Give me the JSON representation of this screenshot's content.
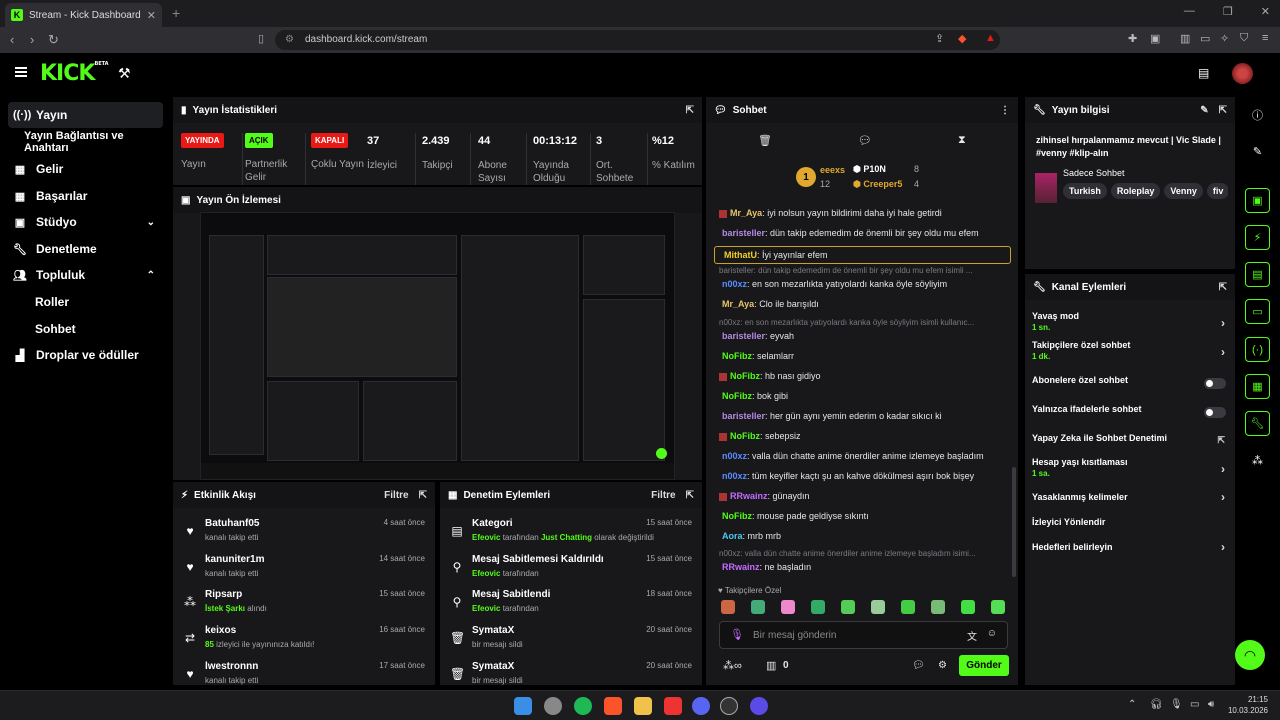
{
  "browser": {
    "tab_title": "Stream - Kick Dashboard",
    "url": "dashboard.kick.com/stream"
  },
  "app": {
    "logo": "KICK",
    "logo_sup": "BETA"
  },
  "sidebar": {
    "items": [
      {
        "label": "Yayın",
        "icon": "broadcast-icon"
      },
      {
        "label": "Yayın Bağlantısı ve Anahtarı"
      },
      {
        "label": "Gelir",
        "icon": "money-icon"
      },
      {
        "label": "Başarılar",
        "icon": "trophy-icon"
      },
      {
        "label": "Stüdyo",
        "icon": "studio-icon"
      },
      {
        "label": "Denetleme",
        "icon": "wrench-icon"
      },
      {
        "label": "Topluluk",
        "icon": "people-icon"
      },
      {
        "label": "Roller"
      },
      {
        "label": "Sohbet"
      },
      {
        "label": "Droplar ve ödüller",
        "icon": "gift-icon"
      }
    ]
  },
  "stats": {
    "title": "Yayın İstatistikleri",
    "items": [
      {
        "value": "YAYINDA",
        "label": "Yayın",
        "pill": "red"
      },
      {
        "value": "AÇIK",
        "label": "Partnerlik Gelir",
        "pill": "green"
      },
      {
        "value": "KAPALI",
        "label": "Çoklu Yayın",
        "pill": "red"
      },
      {
        "value": "37",
        "label": "İzleyici"
      },
      {
        "value": "2.439",
        "label": "Takipçi"
      },
      {
        "value": "44",
        "label": "Abone Sayısı"
      },
      {
        "value": "00:13:12",
        "label": "Yayında Olduğu"
      },
      {
        "value": "3",
        "label": "Ort. Sohbete"
      },
      {
        "value": "%12",
        "label": "% Katılım"
      }
    ]
  },
  "preview": {
    "title": "Yayın Ön İzlemesi"
  },
  "activity": {
    "title": "Etkinlik Akışı",
    "filter": "Filtre",
    "items": [
      {
        "name": "Batuhanf05",
        "desc": "kanalı takip etti",
        "time": "4 saat önce",
        "icon": "heart-icon"
      },
      {
        "name": "kanuniter1m",
        "desc": "kanalı takip etti",
        "time": "14 saat önce",
        "icon": "heart-icon"
      },
      {
        "name": "Ripsarp",
        "hl": "İstek Şarkı",
        "desc": " alındı",
        "time": "15 saat önce",
        "icon": "points-icon"
      },
      {
        "name": "keixos",
        "hl": "85",
        "desc": " izleyici ile yayınınıza katıldı!",
        "time": "16 saat önce",
        "icon": "raid-icon"
      },
      {
        "name": "lwestronnn",
        "desc": "kanalı takip etti",
        "time": "17 saat önce",
        "icon": "heart-icon"
      }
    ]
  },
  "moderation": {
    "title": "Denetim Eylemleri",
    "filter": "Filtre",
    "items": [
      {
        "name": "Kategori",
        "hl": "Efeovic",
        "desc": " tarafından ",
        "hl2": "Just Chatting",
        "desc2": " olarak değiştirildi",
        "time": "15 saat önce",
        "icon": "category-icon"
      },
      {
        "name": "Mesaj Sabitlemesi Kaldırıldı",
        "hl": "Efeovic",
        "desc": " tarafından",
        "time": "15 saat önce",
        "icon": "unpin-icon"
      },
      {
        "name": "Mesaj Sabitlendi",
        "hl": "Efeovic",
        "desc": " tarafından",
        "time": "18 saat önce",
        "icon": "pin-icon"
      },
      {
        "name": "SymataX",
        "desc": "bir mesajı sildi",
        "time": "20 saat önce",
        "icon": "trash-icon"
      },
      {
        "name": "SymataX",
        "desc": "bir mesajı sildi",
        "time": "20 saat önce",
        "icon": "trash-icon"
      }
    ]
  },
  "chat": {
    "title": "Sohbet",
    "leaderboard": {
      "left_name": "eeexs",
      "left_count": "12",
      "right1_name": "P10N",
      "right1_count": "8",
      "right2_name": "Creeper5",
      "right2_count": "4"
    },
    "messages": [
      {
        "type": "msg",
        "user": "Mr_Aya",
        "color": "#e9c46a",
        "text": "iyi nolsun yayın bildirimi daha iyi hale getirdi"
      },
      {
        "type": "msg",
        "user": "baristeller",
        "color": "#b48ae3",
        "text": "dün takip edemedim de önemli bir şey oldu mu efem"
      },
      {
        "type": "hl",
        "user": "MithatU",
        "color": "#f2d024",
        "text": "İyi yayınlar efem"
      },
      {
        "type": "reply",
        "text": "baristeller: dün takip edemedim de önemli bir şey oldu mu efem isimli ..."
      },
      {
        "type": "msg",
        "user": "n00xz",
        "color": "#5a8cff",
        "text": "en son mezarlıkta yatıyolardı kanka öyle söyliyim"
      },
      {
        "type": "msg",
        "user": "Mr_Aya",
        "color": "#e9c46a",
        "text": "Clo ile barışıldı"
      },
      {
        "type": "reply",
        "text": "n00xz: en son mezarlıkta yatıyolardı kanka öyle söyliyim isimli kullanıc..."
      },
      {
        "type": "msg",
        "user": "baristeller",
        "color": "#b48ae3",
        "text": "eyvah"
      },
      {
        "type": "msg",
        "user": "NoFibz",
        "color": "#53fc18",
        "text": "selamlarr"
      },
      {
        "type": "msg",
        "user": "NoFibz",
        "color": "#53fc18",
        "text": "hb nası gidiyo"
      },
      {
        "type": "msg",
        "user": "NoFibz",
        "color": "#53fc18",
        "text": "bok gibi"
      },
      {
        "type": "msg",
        "user": "baristeller",
        "color": "#b48ae3",
        "text": "her gün aynı yemin ederim o kadar sıkıcı ki"
      },
      {
        "type": "msg",
        "user": "NoFibz",
        "color": "#53fc18",
        "text": "sebepsiz"
      },
      {
        "type": "msg",
        "user": "n00xz",
        "color": "#5a8cff",
        "text": "valla dün chatte anime önerdiler anime izlemeye başladım"
      },
      {
        "type": "msg",
        "user": "n00xz",
        "color": "#5a8cff",
        "text": "tüm keyifler kaçtı şu an kahve dökülmesi aşırı bok bişey"
      },
      {
        "type": "msg",
        "user": "RRwainz",
        "color": "#c36bff",
        "text": "günaydın"
      },
      {
        "type": "msg",
        "user": "NoFibz",
        "color": "#53fc18",
        "text": "mouse pade geldiyse sıkıntı"
      },
      {
        "type": "msg",
        "user": "Aora",
        "color": "#4cc9f0",
        "text": "mrb mrb"
      },
      {
        "type": "reply",
        "text": "n00xz: valla dün chatte anime önerdiler anime izlemeye başladım isimi..."
      },
      {
        "type": "msg",
        "user": "RRwainz",
        "color": "#c36bff",
        "text": "ne başladın"
      }
    ],
    "followers_only": "Takipçilere Özel",
    "input_placeholder": "Bir mesaj gönderin",
    "send": "Gönder",
    "points": "0"
  },
  "stream_info": {
    "title_label": "Yayın bilgisi",
    "stream_title": "zihinsel hırpalanmamız mevcut | Vic Slade | #venny #klip-alın",
    "category": "Sadece Sohbet",
    "tags": [
      "Turkish",
      "Roleplay",
      "Venny",
      "fiv"
    ]
  },
  "channel_actions": {
    "title": "Kanal Eylemleri",
    "items": [
      {
        "label": "Yavaş mod",
        "sub": "1 sn.",
        "ctrl": "chev"
      },
      {
        "label": "Takipçilere özel sohbet",
        "sub": "1 dk.",
        "ctrl": "chev"
      },
      {
        "label": "Abonelere özel sohbet",
        "ctrl": "toggle"
      },
      {
        "label": "Yalnızca ifadelerle sohbet",
        "ctrl": "toggle"
      },
      {
        "label": "Yapay Zeka ile Sohbet Denetimi",
        "ctrl": "ext"
      },
      {
        "label": "Hesap yaşı kısıtlaması",
        "sub": "1 sa.",
        "ctrl": "chev"
      },
      {
        "label": "Yasaklanmış kelimeler",
        "ctrl": "chev"
      },
      {
        "label": "İzleyici Yönlendir",
        "ctrl": "none"
      },
      {
        "label": "Hedefleri belirleyin",
        "ctrl": "chev"
      }
    ]
  },
  "taskbar": {
    "time": "21:15",
    "date": "10.03.2026"
  },
  "colors": {
    "accent": "#53fc18",
    "live": "#e91916",
    "panel": "#18181b"
  }
}
